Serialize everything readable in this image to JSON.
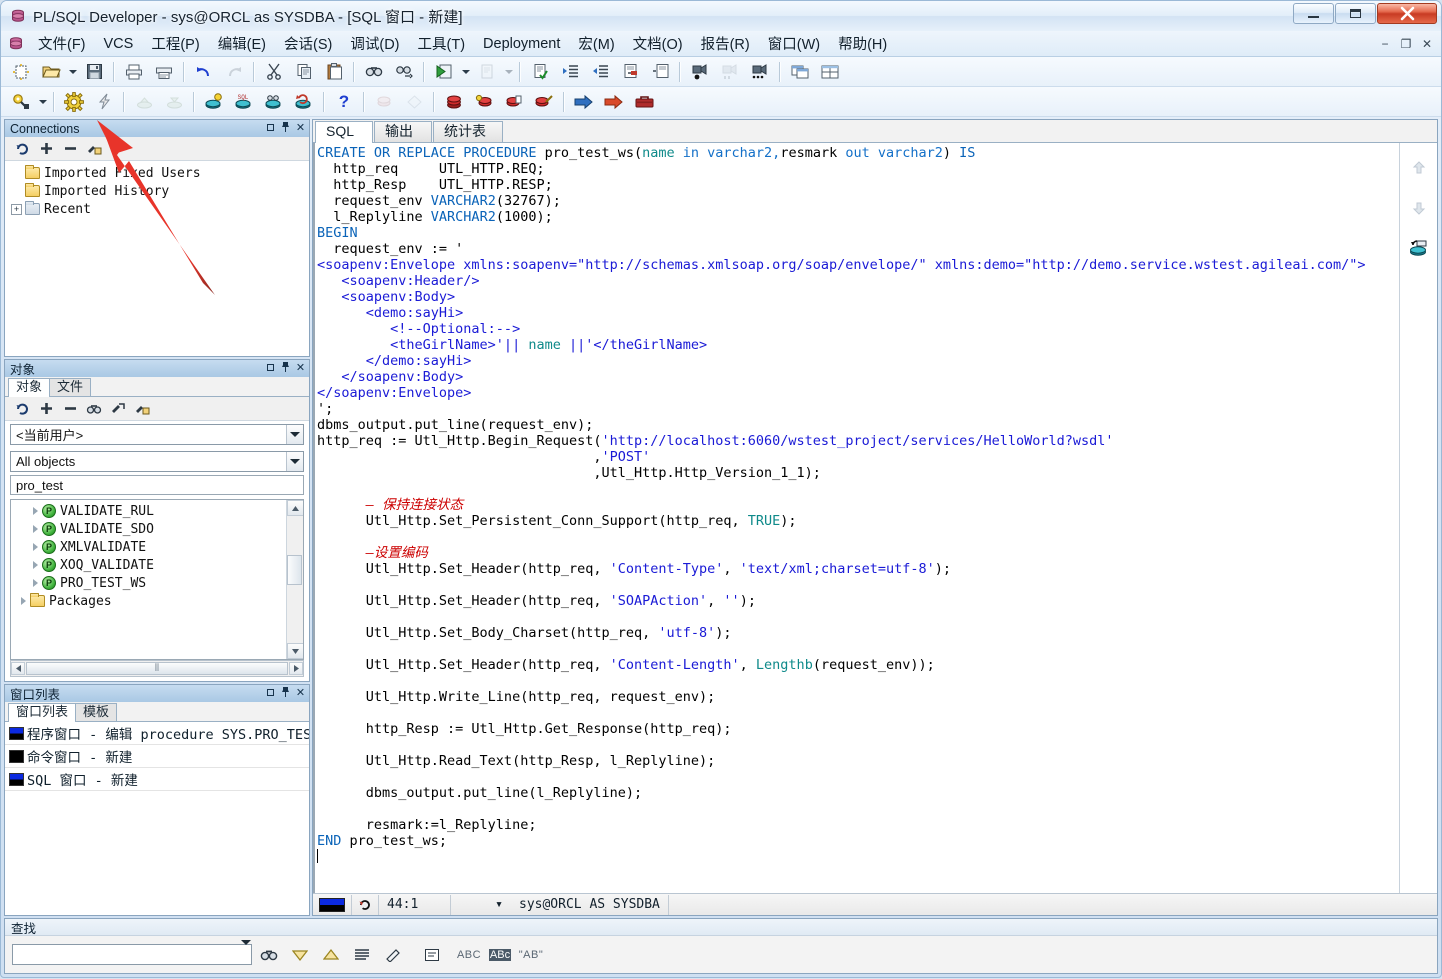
{
  "window": {
    "title": "PL/SQL Developer - sys@ORCL as SYSDBA - [SQL 窗口 - 新建]",
    "icon": "database-icon",
    "minimize_label": "−",
    "maximize_label": "□",
    "close_label": "✕"
  },
  "mdi_buttons": {
    "minimize": "−",
    "restore": "❐",
    "close": "✕"
  },
  "menubar": {
    "items": [
      {
        "label": "文件(F)"
      },
      {
        "label": "VCS"
      },
      {
        "label": "工程(P)"
      },
      {
        "label": "编辑(E)"
      },
      {
        "label": "会话(S)"
      },
      {
        "label": "调试(D)"
      },
      {
        "label": "工具(T)"
      },
      {
        "label": "Deployment"
      },
      {
        "label": "宏(M)"
      },
      {
        "label": "文档(O)"
      },
      {
        "label": "报告(R)"
      },
      {
        "label": "窗口(W)"
      },
      {
        "label": "帮助(H)"
      }
    ]
  },
  "toolbar1": {
    "buttons": [
      "new-icon",
      "open-folder-icon",
      "open-dropdown-caret",
      "save-icon",
      "print-icon",
      "print-preview-icon",
      "undo-icon",
      "redo-icon",
      "cut-icon",
      "copy-icon",
      "paste-icon",
      "find-icon",
      "find-next-icon",
      "execute-green-icon",
      "execute-dropdown-caret",
      "explain-plan-icon",
      "explain-dropdown-caret",
      "check-document-icon",
      "indent-icon",
      "outdent-icon",
      "comment-icon",
      "uncomment-icon",
      "breakpoint-record-icon",
      "record-pause-icon",
      "record-more-icon",
      "window-cascade-icon",
      "window-tile-icon"
    ]
  },
  "toolbar2": {
    "buttons": [
      "search-key-icon",
      "search-dropdown-caret",
      "gear-settings-icon",
      "lightning-icon",
      "import-disabled-icon",
      "export-disabled-icon",
      "db-bulb-icon",
      "db-sql-icon",
      "db-find-icon",
      "db-refresh-icon",
      "help-question-icon",
      "object-red-disabled-icon",
      "diamond-disabled-icon",
      "red-stack-icon",
      "red-back-icon",
      "red-copy-icon",
      "red-brush-icon",
      "blue-arrow-icon",
      "red-arrow-icon",
      "toolbox-icon"
    ],
    "help_label": "?"
  },
  "connections_panel": {
    "caption": "Connections",
    "mini_toolbar": [
      "refresh-icon",
      "add-icon",
      "remove-icon",
      "edit-user-icon"
    ],
    "tree": [
      {
        "label": "Imported Fixed Users",
        "expander": "",
        "icon": "folder-icon"
      },
      {
        "label": "Imported History",
        "expander": "",
        "icon": "folder-icon"
      },
      {
        "label": "Recent",
        "expander": "+",
        "icon": "folder-grey-icon"
      }
    ]
  },
  "objects_panel": {
    "caption": "对象",
    "tabs": [
      {
        "label": "对象",
        "active": true
      },
      {
        "label": "文件",
        "active": false
      }
    ],
    "mini_toolbar": [
      "refresh-icon",
      "add-icon",
      "remove-icon",
      "find-icon",
      "filter-icon",
      "user-lock-icon"
    ],
    "user_combo": "<当前用户>",
    "filter_combo": "All objects",
    "search_value": "pro_test",
    "list": [
      {
        "label": "VALIDATE_RUL",
        "icon": "procedure-icon"
      },
      {
        "label": "VALIDATE_SDO",
        "icon": "procedure-icon"
      },
      {
        "label": "XMLVALIDATE",
        "icon": "procedure-icon"
      },
      {
        "label": "XOQ_VALIDATE",
        "icon": "procedure-icon"
      },
      {
        "label": "PRO_TEST_WS",
        "icon": "procedure-icon"
      },
      {
        "label": "Packages",
        "icon": "folder-icon"
      }
    ]
  },
  "windowlist_panel": {
    "caption": "窗口列表",
    "tabs": [
      {
        "label": "窗口列表",
        "active": true
      },
      {
        "label": "模板",
        "active": false
      }
    ],
    "rows": [
      {
        "label": "程序窗口 - 编辑 procedure SYS.PRO_TES"
      },
      {
        "label": "命令窗口 - 新建"
      },
      {
        "label": "SQL 窗口 - 新建"
      }
    ]
  },
  "sql_window": {
    "tabs": [
      {
        "label": "SQL",
        "active": true
      },
      {
        "label": "输出",
        "active": false
      },
      {
        "label": "统计表",
        "active": false
      }
    ],
    "gutter_icons": [
      "scroll-up-disabled-icon",
      "scroll-down-disabled-icon",
      "db-refresh-icon"
    ],
    "status": {
      "mode_icon": "window-state-icon",
      "rollback_icon": "rollback-icon",
      "cursor_position": "44:1",
      "session_caret": "▾",
      "session": "sys@ORCL AS SYSDBA"
    },
    "code_lines": [
      [
        {
          "t": "CREATE OR REPLACE PROCEDURE ",
          "c": "kw"
        },
        {
          "t": "pro_test_ws",
          "c": "dark"
        },
        {
          "t": "(",
          "c": "dark"
        },
        {
          "t": "name",
          "c": "teal"
        },
        {
          "t": " in varchar2,",
          "c": "kw2"
        },
        {
          "t": "resmark",
          "c": "dark"
        },
        {
          "t": " out varchar2",
          "c": "kw2"
        },
        {
          "t": ") ",
          "c": "dark"
        },
        {
          "t": "IS",
          "c": "kw"
        }
      ],
      [
        {
          "t": "  http_req     UTL_HTTP.REQ;",
          "c": "dark"
        }
      ],
      [
        {
          "t": "  http_Resp    UTL_HTTP.RESP;",
          "c": "dark"
        }
      ],
      [
        {
          "t": "  request_env ",
          "c": "dark"
        },
        {
          "t": "VARCHAR2",
          "c": "kw"
        },
        {
          "t": "(32767);",
          "c": "dark"
        }
      ],
      [
        {
          "t": "  l_Replyline ",
          "c": "dark"
        },
        {
          "t": "VARCHAR2",
          "c": "kw"
        },
        {
          "t": "(1000);",
          "c": "dark"
        }
      ],
      [
        {
          "t": "BEGIN",
          "c": "kw"
        }
      ],
      [
        {
          "t": "  request_env := '",
          "c": "dark"
        }
      ],
      [
        {
          "t": "<soapenv:Envelope xmlns:soapenv=\"http://schemas.xmlsoap.org/soap/envelope/\" xmlns:demo=\"http://demo.service.wstest.agileai.com/\">",
          "c": "str"
        }
      ],
      [
        {
          "t": "   <soapenv:Header/>",
          "c": "str"
        }
      ],
      [
        {
          "t": "   <soapenv:Body>",
          "c": "str"
        }
      ],
      [
        {
          "t": "      <demo:sayHi>",
          "c": "str"
        }
      ],
      [
        {
          "t": "         <!--Optional:-->",
          "c": "str"
        }
      ],
      [
        {
          "t": "         <theGirlName>'|| ",
          "c": "str"
        },
        {
          "t": "name",
          "c": "teal"
        },
        {
          "t": " ||'</theGirlName>",
          "c": "str"
        }
      ],
      [
        {
          "t": "      </demo:sayHi>",
          "c": "str"
        }
      ],
      [
        {
          "t": "   </soapenv:Body>",
          "c": "str"
        }
      ],
      [
        {
          "t": "</soapenv:Envelope>",
          "c": "str"
        }
      ],
      [
        {
          "t": "';",
          "c": "dark"
        }
      ],
      [
        {
          "t": "dbms_output.put_line(request_env);",
          "c": "dark"
        }
      ],
      [
        {
          "t": "http_req := Utl_Http.Begin_Request(",
          "c": "dark"
        },
        {
          "t": "'http://localhost:6060/wstest_project/services/HelloWorld?wsdl'",
          "c": "str"
        }
      ],
      [
        {
          "t": "                                  ,",
          "c": "dark"
        },
        {
          "t": "'POST'",
          "c": "str"
        }
      ],
      [
        {
          "t": "                                  ,Utl_Http.Http_Version_1_1);",
          "c": "dark"
        }
      ],
      [
        {
          "t": "",
          "c": "dark"
        }
      ],
      [
        {
          "t": "      — 保持连接状态",
          "c": "cmt"
        }
      ],
      [
        {
          "t": "      Utl_Http.Set_Persistent_Conn_Support(http_req, ",
          "c": "dark"
        },
        {
          "t": "TRUE",
          "c": "teal"
        },
        {
          "t": ");",
          "c": "dark"
        }
      ],
      [
        {
          "t": "",
          "c": "dark"
        }
      ],
      [
        {
          "t": "      —设置编码",
          "c": "cmt"
        }
      ],
      [
        {
          "t": "      Utl_Http.Set_Header(http_req, ",
          "c": "dark"
        },
        {
          "t": "'Content-Type'",
          "c": "str"
        },
        {
          "t": ", ",
          "c": "dark"
        },
        {
          "t": "'text/xml;charset=utf-8'",
          "c": "str"
        },
        {
          "t": ");",
          "c": "dark"
        }
      ],
      [
        {
          "t": "",
          "c": "dark"
        }
      ],
      [
        {
          "t": "      Utl_Http.Set_Header(http_req, ",
          "c": "dark"
        },
        {
          "t": "'SOAPAction'",
          "c": "str"
        },
        {
          "t": ", ",
          "c": "dark"
        },
        {
          "t": "''",
          "c": "str"
        },
        {
          "t": ");",
          "c": "dark"
        }
      ],
      [
        {
          "t": "",
          "c": "dark"
        }
      ],
      [
        {
          "t": "      Utl_Http.Set_Body_Charset(http_req, ",
          "c": "dark"
        },
        {
          "t": "'utf-8'",
          "c": "str"
        },
        {
          "t": ");",
          "c": "dark"
        }
      ],
      [
        {
          "t": "",
          "c": "dark"
        }
      ],
      [
        {
          "t": "      Utl_Http.Set_Header(http_req, ",
          "c": "dark"
        },
        {
          "t": "'Content-Length'",
          "c": "str"
        },
        {
          "t": ", ",
          "c": "dark"
        },
        {
          "t": "Lengthb",
          "c": "teal"
        },
        {
          "t": "(request_env));",
          "c": "dark"
        }
      ],
      [
        {
          "t": "",
          "c": "dark"
        }
      ],
      [
        {
          "t": "      Utl_Http.Write_Line(http_req, request_env);",
          "c": "dark"
        }
      ],
      [
        {
          "t": "",
          "c": "dark"
        }
      ],
      [
        {
          "t": "      http_Resp := Utl_Http.Get_Response(http_req);",
          "c": "dark"
        }
      ],
      [
        {
          "t": "",
          "c": "dark"
        }
      ],
      [
        {
          "t": "      Utl_Http.Read_Text(http_Resp, l_Replyline);",
          "c": "dark"
        }
      ],
      [
        {
          "t": "",
          "c": "dark"
        }
      ],
      [
        {
          "t": "      dbms_output.put_line(l_Replyline);",
          "c": "dark"
        }
      ],
      [
        {
          "t": "",
          "c": "dark"
        }
      ],
      [
        {
          "t": "      resmark:=l_Replyline;",
          "c": "dark"
        }
      ],
      [
        {
          "t": "END",
          "c": "kw"
        },
        {
          "t": " pro_test_ws;",
          "c": "dark"
        }
      ]
    ]
  },
  "findbar": {
    "caption": "查找",
    "input_value": "",
    "buttons": [
      "find-binoculars-icon",
      "find-down-icon",
      "find-up-icon",
      "find-all-icon",
      "clear-highlight-icon",
      "find-in-list-icon",
      "match-case-off-icon",
      "match-case-on-icon",
      "whole-word-icon"
    ],
    "abc_label": "ABC",
    "abc_hl_label": "ABc",
    "quote_label": "\"AB\""
  },
  "annotation": {
    "type": "red-arrow",
    "points_to": "gear-settings-icon",
    "color": "#e8342a"
  }
}
